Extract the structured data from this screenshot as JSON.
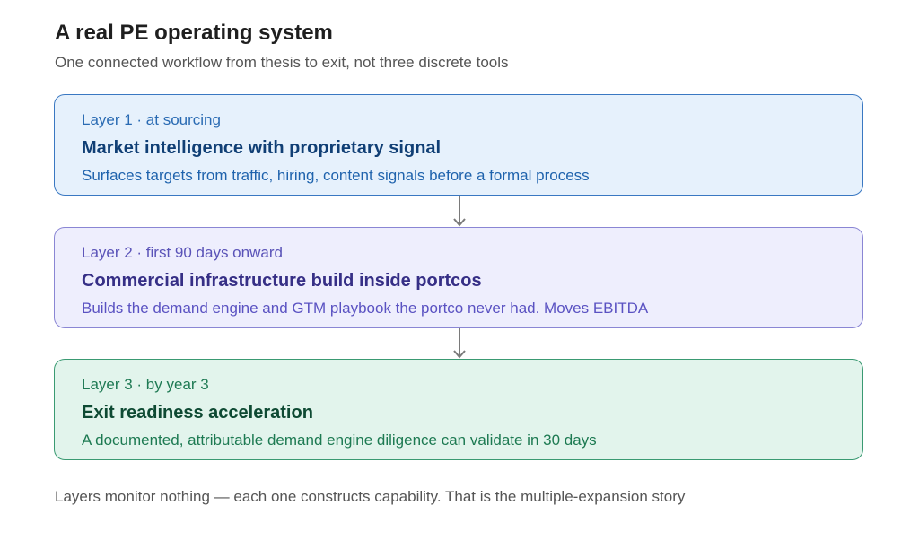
{
  "header": {
    "title": "A real PE operating system",
    "subtitle": "One connected workflow from thesis to exit, not three discrete tools"
  },
  "layers": [
    {
      "kicker": "Layer 1 · at sourcing",
      "heading": "Market intelligence with proprietary signal",
      "description": "Surfaces targets from traffic, hiring, content signals before a formal process"
    },
    {
      "kicker": "Layer 2 · first 90 days onward",
      "heading": "Commercial infrastructure build inside portcos",
      "description": "Builds the demand engine and GTM playbook the portco never had. Moves EBITDA"
    },
    {
      "kicker": "Layer 3 · by year 3",
      "heading": "Exit readiness acceleration",
      "description": "A documented, attributable demand engine diligence can validate in 30 days"
    }
  ],
  "footer": {
    "note": "Layers monitor nothing — each one constructs capability. That is the multiple-expansion story"
  },
  "colors": {
    "layer1_fill": "#e6f1fc",
    "layer1_border": "#3a78c2",
    "layer2_fill": "#eeeefd",
    "layer2_border": "#8a86d4",
    "layer3_fill": "#e2f4ec",
    "layer3_border": "#3a9a72",
    "connector": "#7a7a7a"
  },
  "icons": {
    "connector": "arrow-down-icon"
  }
}
